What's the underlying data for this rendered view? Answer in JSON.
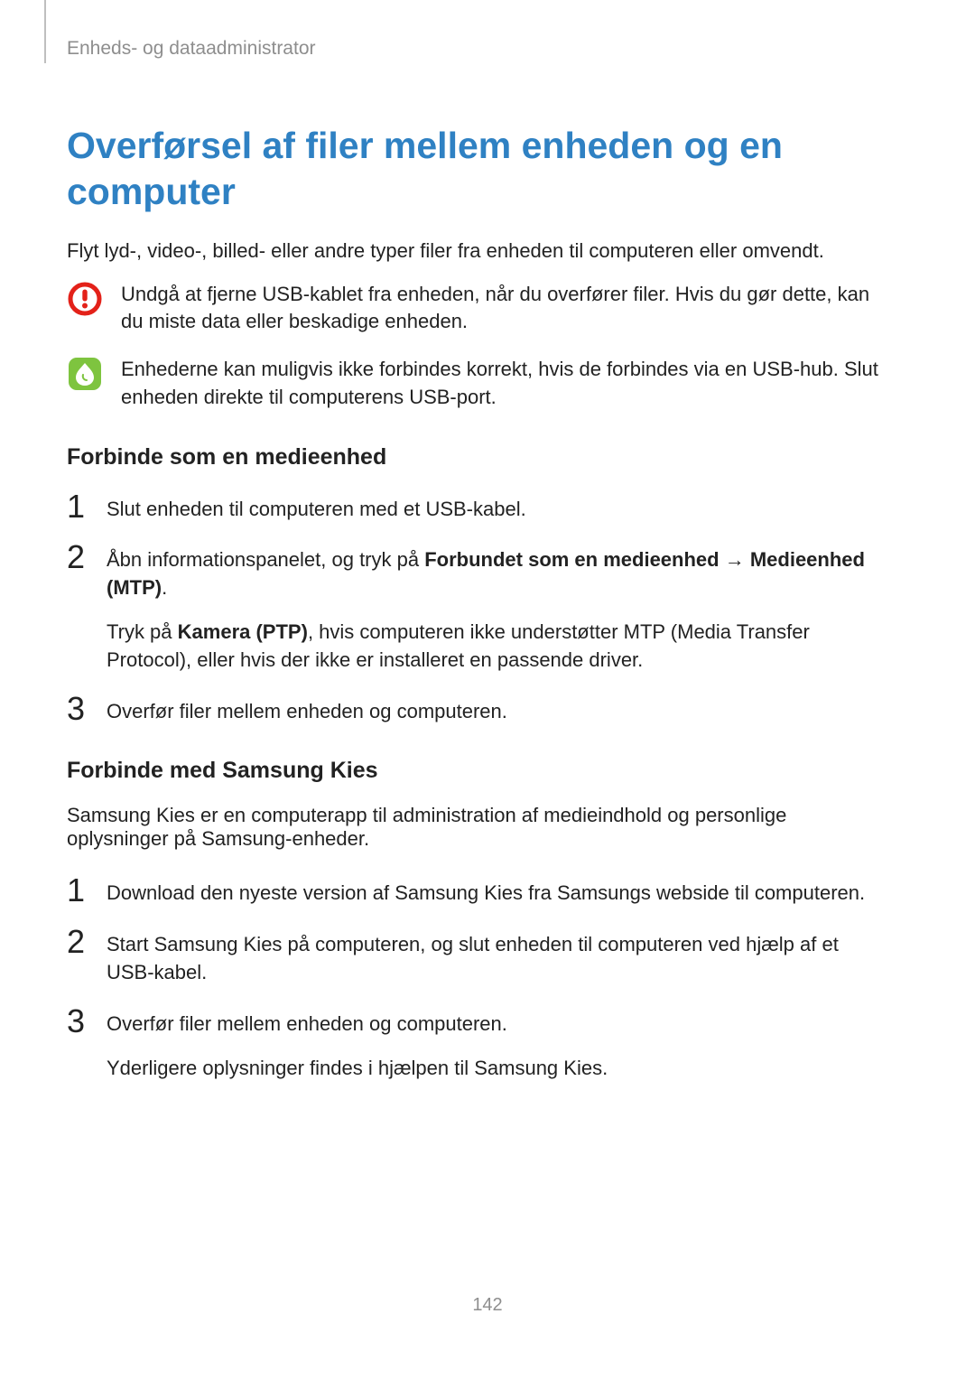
{
  "breadcrumb": "Enheds- og dataadministrator",
  "title": "Overførsel af filer mellem enheden og en computer",
  "intro": "Flyt lyd-, video-, billed- eller andre typer filer fra enheden til computeren eller omvendt.",
  "warning": {
    "text": "Undgå at fjerne USB-kablet fra enheden, når du overfører filer. Hvis du gør dette, kan du miste data eller beskadige enheden."
  },
  "info": {
    "text": "Enhederne kan muligvis ikke forbindes korrekt, hvis de forbindes via en USB-hub. Slut enheden direkte til computerens USB-port."
  },
  "section1": {
    "heading": "Forbinde som en medieenhed",
    "step1": "Slut enheden til computeren med et USB-kabel.",
    "step2": {
      "prefix": "Åbn informationspanelet, og tryk på ",
      "bold1": "Forbundet som en medieenhed",
      "arrow": " → ",
      "bold2": "Medieenhed (MTP)",
      "suffix": ".",
      "para2_prefix": "Tryk på ",
      "para2_bold": "Kamera (PTP)",
      "para2_suffix": ", hvis computeren ikke understøtter MTP (Media Transfer Protocol), eller hvis der ikke er installeret en passende driver."
    },
    "step3": "Overfør filer mellem enheden og computeren."
  },
  "section2": {
    "heading": "Forbinde med Samsung Kies",
    "intro": "Samsung Kies er en computerapp til administration af medieindhold og personlige oplysninger på Samsung-enheder.",
    "step1": "Download den nyeste version af Samsung Kies fra Samsungs webside til computeren.",
    "step2": "Start Samsung Kies på computeren, og slut enheden til computeren ved hjælp af et USB-kabel.",
    "step3": {
      "line1": "Overfør filer mellem enheden og computeren.",
      "line2": "Yderligere oplysninger findes i hjælpen til Samsung Kies."
    }
  },
  "numbers": {
    "n1": "1",
    "n2": "2",
    "n3": "3"
  },
  "page_number": "142"
}
